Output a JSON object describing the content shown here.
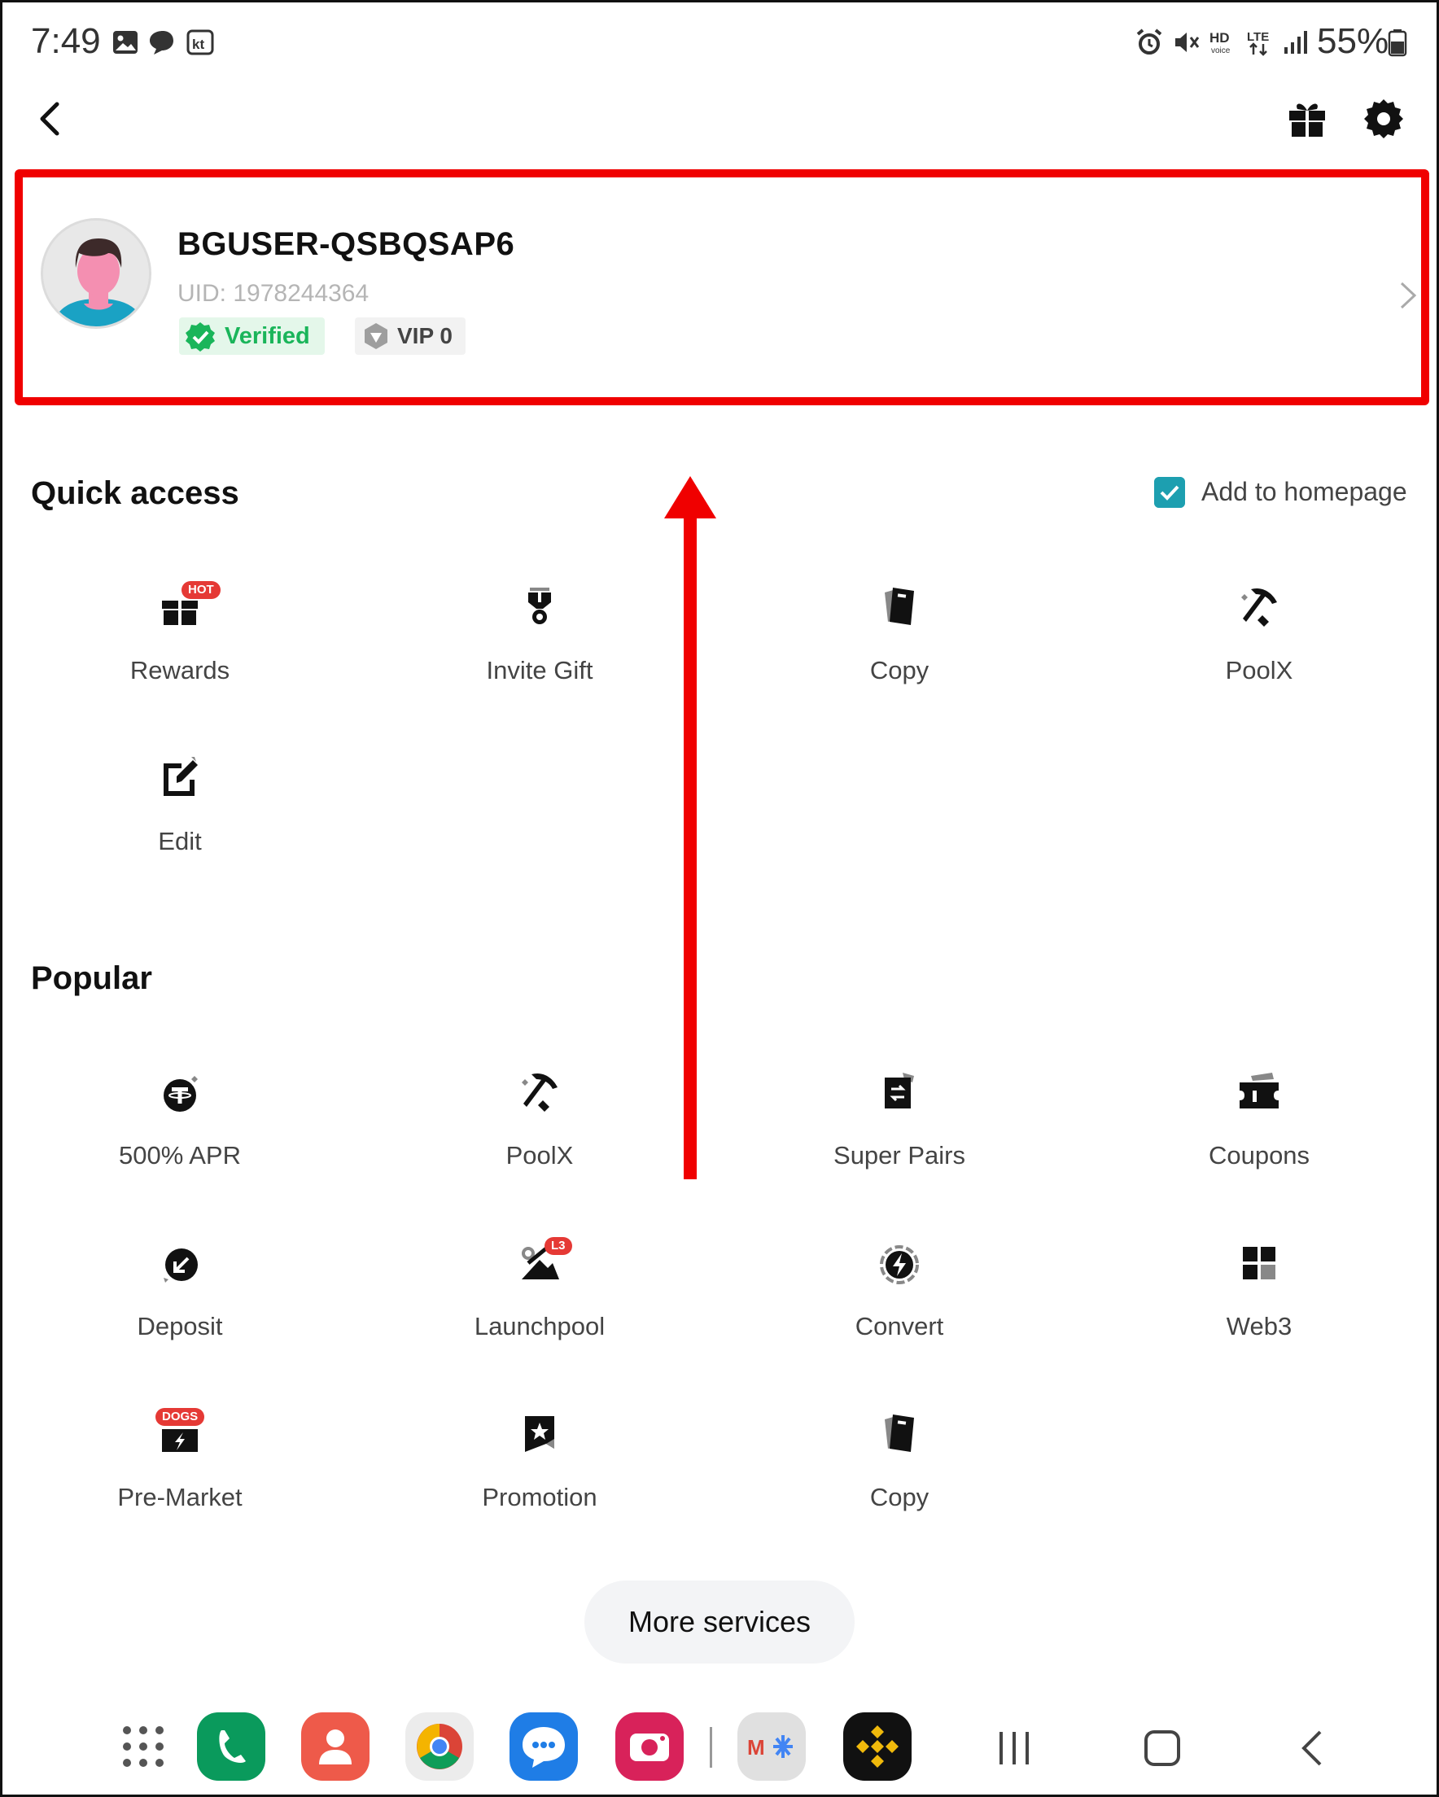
{
  "status_bar": {
    "time": "7:49",
    "battery": "55%",
    "icons": [
      "gallery-icon",
      "message-bubble-icon",
      "kt-icon",
      "alarm-icon",
      "mute-icon",
      "hd-voice-icon",
      "lte-icon",
      "signal-icon",
      "battery-icon"
    ]
  },
  "header": {
    "back_icon": "chevron-left-icon",
    "gift_icon": "gift-icon",
    "settings_icon": "gear-icon"
  },
  "profile": {
    "username": "BGUSER-QSBQSAP6",
    "uid": "UID: 1978244364",
    "verified_label": "Verified",
    "vip_label": "VIP 0"
  },
  "quick_access": {
    "title": "Quick access",
    "add_to_homepage_label": "Add to homepage",
    "add_to_homepage_checked": true,
    "items": [
      {
        "label": "Rewards",
        "icon": "rewards-gift-icon",
        "tag": "HOT"
      },
      {
        "label": "Invite Gift",
        "icon": "invite-medal-icon",
        "tag": ""
      },
      {
        "label": "Copy",
        "icon": "copy-cards-icon",
        "tag": ""
      },
      {
        "label": "PoolX",
        "icon": "pickaxe-icon",
        "tag": ""
      },
      {
        "label": "Edit",
        "icon": "edit-icon",
        "tag": ""
      }
    ]
  },
  "popular": {
    "title": "Popular",
    "items": [
      {
        "label": "500% APR",
        "icon": "tether-icon",
        "tag": ""
      },
      {
        "label": "PoolX",
        "icon": "pickaxe-icon",
        "tag": ""
      },
      {
        "label": "Super Pairs",
        "icon": "swap-cards-icon",
        "tag": ""
      },
      {
        "label": "Coupons",
        "icon": "ticket-icon",
        "tag": ""
      },
      {
        "label": "Deposit",
        "icon": "deposit-arrow-icon",
        "tag": ""
      },
      {
        "label": "Launchpool",
        "icon": "launchpool-icon",
        "tag": "L3"
      },
      {
        "label": "Convert",
        "icon": "convert-bolt-icon",
        "tag": ""
      },
      {
        "label": "Web3",
        "icon": "web3-blocks-icon",
        "tag": ""
      },
      {
        "label": "Pre-Market",
        "icon": "pre-market-icon",
        "tag": "DOGS"
      },
      {
        "label": "Promotion",
        "icon": "promotion-star-icon",
        "tag": ""
      },
      {
        "label": "Copy",
        "icon": "copy-cards-icon",
        "tag": ""
      }
    ]
  },
  "more_services_label": "More services",
  "dock": {
    "items": [
      "apps-grid-icon",
      "phone-app-icon",
      "contacts-app-icon",
      "chrome-app-icon",
      "messages-app-icon",
      "camera-app-icon",
      "google-folder-icon",
      "binance-app-icon"
    ],
    "nav": [
      "recents-icon",
      "home-icon",
      "back-nav-icon"
    ]
  },
  "colors": {
    "highlight_red": "#f00000",
    "verified_green": "#1ab55a",
    "checkbox_teal": "#1d9fb0",
    "tag_red": "#e53935"
  }
}
